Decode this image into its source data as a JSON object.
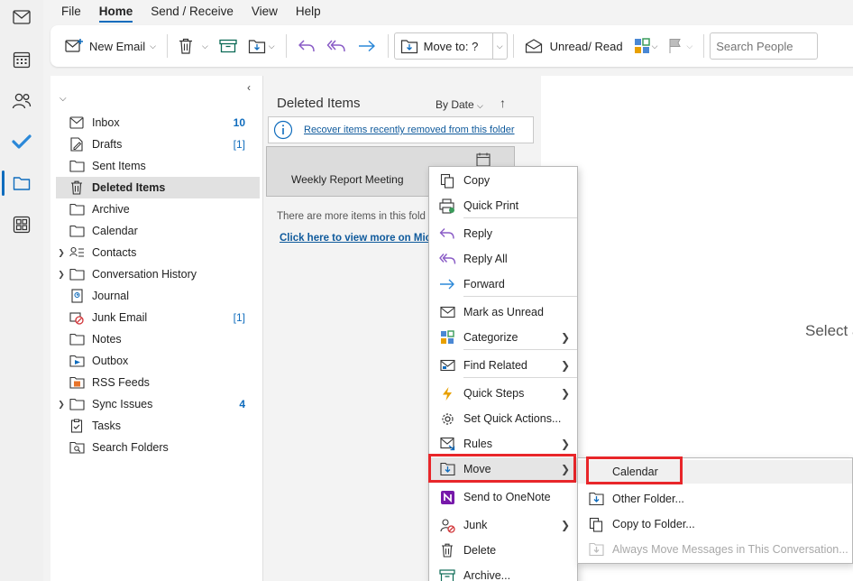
{
  "menu_tabs": [
    "File",
    "Home",
    "Send / Receive",
    "View",
    "Help"
  ],
  "active_tab": "Home",
  "ribbon": {
    "new_email": "New Email",
    "move_to": "Move to: ?",
    "unread_read": "Unread/ Read",
    "search_placeholder": "Search People"
  },
  "rail_icons": [
    "mail-icon",
    "calendar-icon",
    "people-icon",
    "todo-icon",
    "folder-icon",
    "apps-icon"
  ],
  "folders": [
    {
      "name": "Inbox",
      "count": "10",
      "icon": "inbox-icon"
    },
    {
      "name": "Drafts",
      "count": "[1]",
      "icon": "drafts-icon"
    },
    {
      "name": "Sent Items",
      "count": "",
      "icon": "folder-icon"
    },
    {
      "name": "Deleted Items",
      "count": "",
      "icon": "trash-icon",
      "selected": true
    },
    {
      "name": "Archive",
      "count": "",
      "icon": "folder-icon"
    },
    {
      "name": "Calendar",
      "count": "",
      "icon": "folder-icon"
    },
    {
      "name": "Contacts",
      "count": "",
      "icon": "contacts-icon",
      "expandable": true
    },
    {
      "name": "Conversation History",
      "count": "",
      "icon": "folder-icon",
      "expandable": true
    },
    {
      "name": "Journal",
      "count": "",
      "icon": "journal-icon"
    },
    {
      "name": "Junk Email",
      "count": "[1]",
      "icon": "junk-icon"
    },
    {
      "name": "Notes",
      "count": "",
      "icon": "folder-icon"
    },
    {
      "name": "Outbox",
      "count": "",
      "icon": "outbox-icon"
    },
    {
      "name": "RSS Feeds",
      "count": "",
      "icon": "rss-icon"
    },
    {
      "name": "Sync Issues",
      "count": "4",
      "icon": "folder-icon",
      "expandable": true
    },
    {
      "name": "Tasks",
      "count": "",
      "icon": "tasks-icon"
    },
    {
      "name": "Search Folders",
      "count": "",
      "icon": "search-folder-icon"
    }
  ],
  "message_list": {
    "title": "Deleted Items",
    "sort_label": "By Date",
    "recover_link": "Recover items recently removed from this folder",
    "message_subject": "Weekly Report Meeting",
    "more_items_text": "There are more items in this fold",
    "view_more_link": "Click here to view more on Micr"
  },
  "reading_pane": {
    "select_text": "Select a"
  },
  "context_menu": [
    {
      "label": "Copy",
      "icon": "copy-icon"
    },
    {
      "label": "Quick Print",
      "icon": "print-icon"
    },
    {
      "label": "Reply",
      "icon": "reply-icon"
    },
    {
      "label": "Reply All",
      "icon": "reply-all-icon"
    },
    {
      "label": "Forward",
      "icon": "forward-icon"
    },
    {
      "label": "Mark as Unread",
      "icon": "envelope-icon"
    },
    {
      "label": "Categorize",
      "icon": "categorize-icon",
      "submenu": true
    },
    {
      "label": "Find Related",
      "icon": "find-related-icon",
      "submenu": true
    },
    {
      "label": "Quick Steps",
      "icon": "lightning-icon",
      "submenu": true
    },
    {
      "label": "Set Quick Actions...",
      "icon": "gear-icon"
    },
    {
      "label": "Rules",
      "icon": "rules-icon",
      "submenu": true
    },
    {
      "label": "Move",
      "icon": "move-icon",
      "submenu": true,
      "highlighted": true
    },
    {
      "label": "Send to OneNote",
      "icon": "onenote-icon"
    },
    {
      "label": "Junk",
      "icon": "junk-icon",
      "submenu": true
    },
    {
      "label": "Delete",
      "icon": "trash-icon"
    },
    {
      "label": "Archive...",
      "icon": "archive-icon"
    }
  ],
  "move_submenu": [
    {
      "label": "Calendar",
      "icon": "",
      "highlighted": true
    },
    {
      "label": "Other Folder...",
      "icon": "move-icon"
    },
    {
      "label": "Copy to Folder...",
      "icon": "copy-icon"
    },
    {
      "label": "Always Move Messages in This Conversation...",
      "icon": "move-icon",
      "disabled": true
    }
  ],
  "colors": {
    "accent": "#0f6cbd",
    "highlight_box": "#e8262a",
    "onenote": "#7719aa",
    "lightning": "#e8a000",
    "junk": "#d13438"
  }
}
